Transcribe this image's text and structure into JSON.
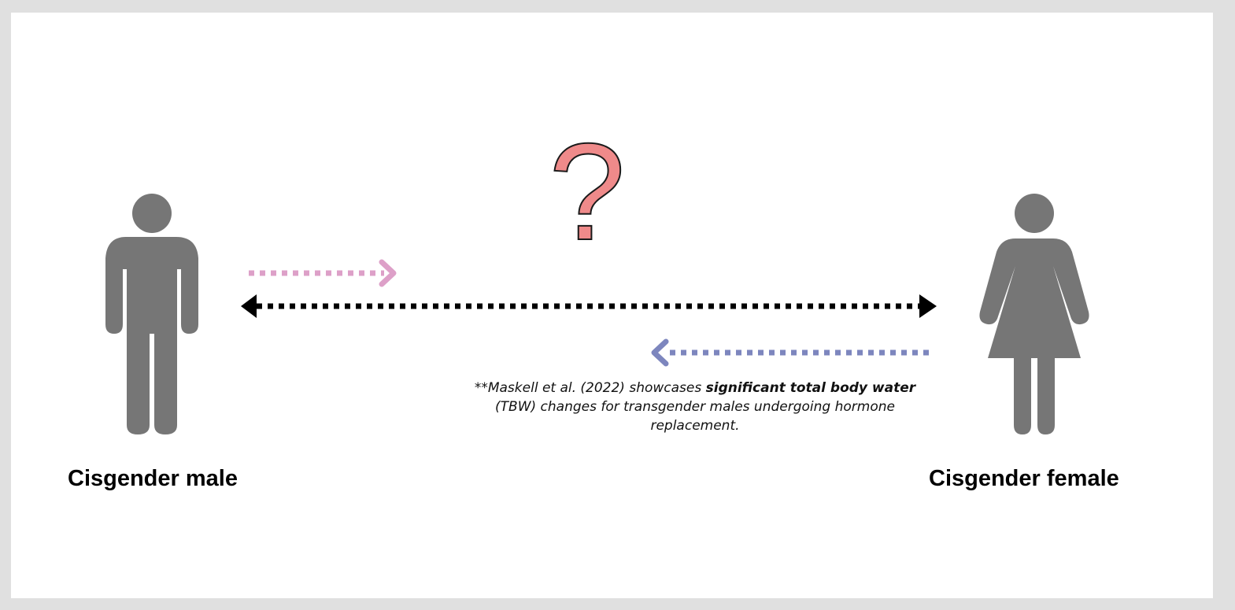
{
  "labels": {
    "left": "Cisgender male",
    "right": "Cisgender female"
  },
  "question_mark": "?",
  "note": {
    "prefix": "**Maskell et al. (2022) showcases ",
    "emphasis": "significant total body water",
    "suffix": " (TBW) changes for transgender males undergoing hormone replacement."
  },
  "colors": {
    "figure": "#767676",
    "pink_arrow": "#dda0c8",
    "blue_arrow": "#7d86be",
    "question_fill": "#ef8a8a",
    "black_arrow": "#000000"
  },
  "icons": {
    "left_figure": "male-person-icon",
    "right_figure": "female-person-icon"
  }
}
